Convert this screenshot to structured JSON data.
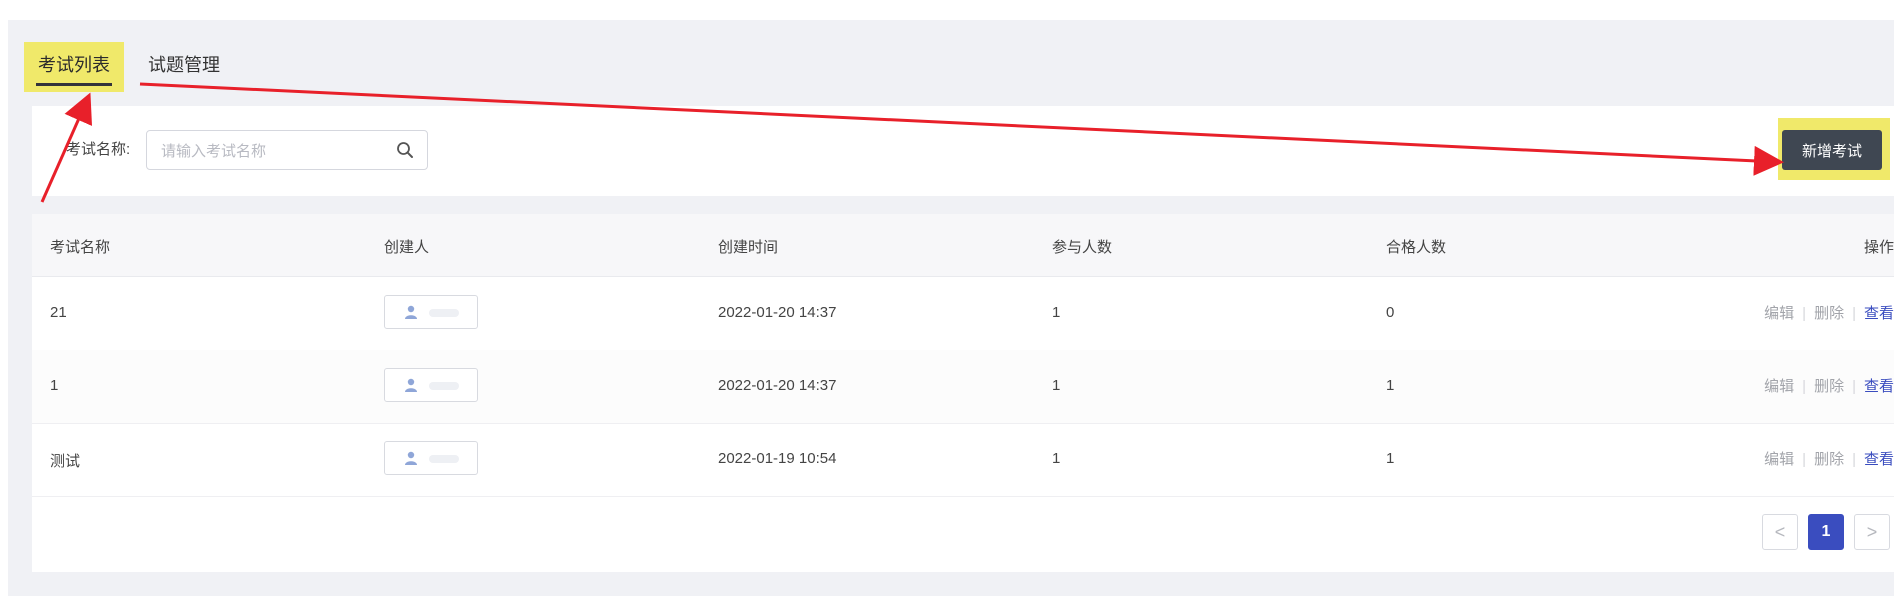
{
  "tabs": [
    {
      "label": "考试列表",
      "active": true
    },
    {
      "label": "试题管理",
      "active": false
    }
  ],
  "search": {
    "label": "考试名称:",
    "placeholder": "请输入考试名称",
    "value": ""
  },
  "toolbar": {
    "add_exam_label": "新增考试"
  },
  "table": {
    "columns": [
      "考试名称",
      "创建人",
      "创建时间",
      "参与人数",
      "合格人数",
      "操作"
    ],
    "rows": [
      {
        "name": "21",
        "created_at": "2022-01-20 14:37",
        "participants": "1",
        "passed": "0"
      },
      {
        "name": "1",
        "created_at": "2022-01-20 14:37",
        "participants": "1",
        "passed": "1"
      },
      {
        "name": "测试",
        "created_at": "2022-01-19 10:54",
        "participants": "1",
        "passed": "1"
      }
    ],
    "actions": {
      "edit": "编辑",
      "delete": "删除",
      "view": "查看"
    }
  },
  "pagination": {
    "prev": "<",
    "current": "1",
    "next": ">"
  },
  "colors": {
    "highlight": "#f0e96a",
    "arrow": "#e8202a",
    "primary": "#3a4dbf",
    "button_dark": "#3f4752"
  }
}
